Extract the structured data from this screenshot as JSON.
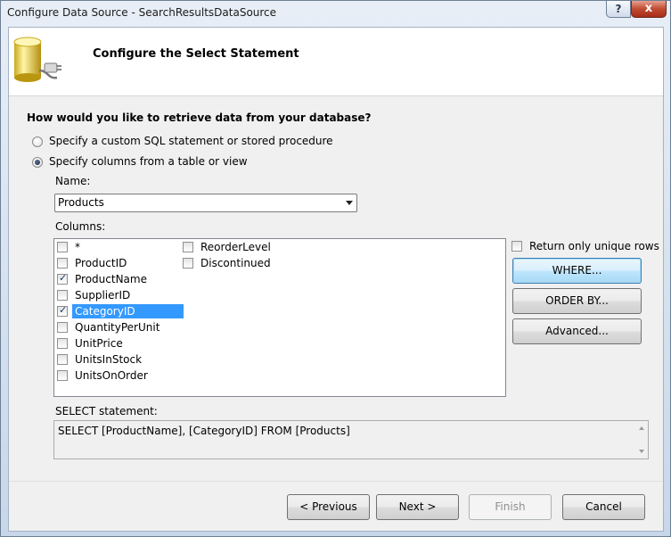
{
  "window": {
    "title": "Configure Data Source - SearchResultsDataSource",
    "help_label": "?",
    "close_label": "x"
  },
  "header": {
    "title": "Configure the Select Statement"
  },
  "question": "How would you like to retrieve data from your database?",
  "options": [
    {
      "label": "Specify a custom SQL statement or stored procedure",
      "selected": false
    },
    {
      "label": "Specify columns from a table or view",
      "selected": true
    }
  ],
  "name_label": "Name:",
  "name_value": "Products",
  "columns_label": "Columns:",
  "columns": [
    {
      "label": "*",
      "checked": false
    },
    {
      "label": "ProductID",
      "checked": false
    },
    {
      "label": "ProductName",
      "checked": true
    },
    {
      "label": "SupplierID",
      "checked": false
    },
    {
      "label": "CategoryID",
      "checked": true,
      "selected": true
    },
    {
      "label": "QuantityPerUnit",
      "checked": false
    },
    {
      "label": "UnitPrice",
      "checked": false
    },
    {
      "label": "UnitsInStock",
      "checked": false
    },
    {
      "label": "UnitsOnOrder",
      "checked": false
    },
    {
      "label": "ReorderLevel",
      "checked": false
    },
    {
      "label": "Discontinued",
      "checked": false
    }
  ],
  "unique_rows_label": "Return only unique rows",
  "side_buttons": {
    "where": "WHERE...",
    "order_by": "ORDER BY...",
    "advanced": "Advanced..."
  },
  "select_label": "SELECT statement:",
  "select_statement": "SELECT [ProductName], [CategoryID] FROM [Products]",
  "footer_buttons": {
    "previous": "< Previous",
    "next": "Next >",
    "finish": "Finish",
    "cancel": "Cancel"
  },
  "colors": {
    "selection": "#3399ff",
    "header_bg": "#ffffff",
    "dialog_bg": "#f0f0f0"
  }
}
